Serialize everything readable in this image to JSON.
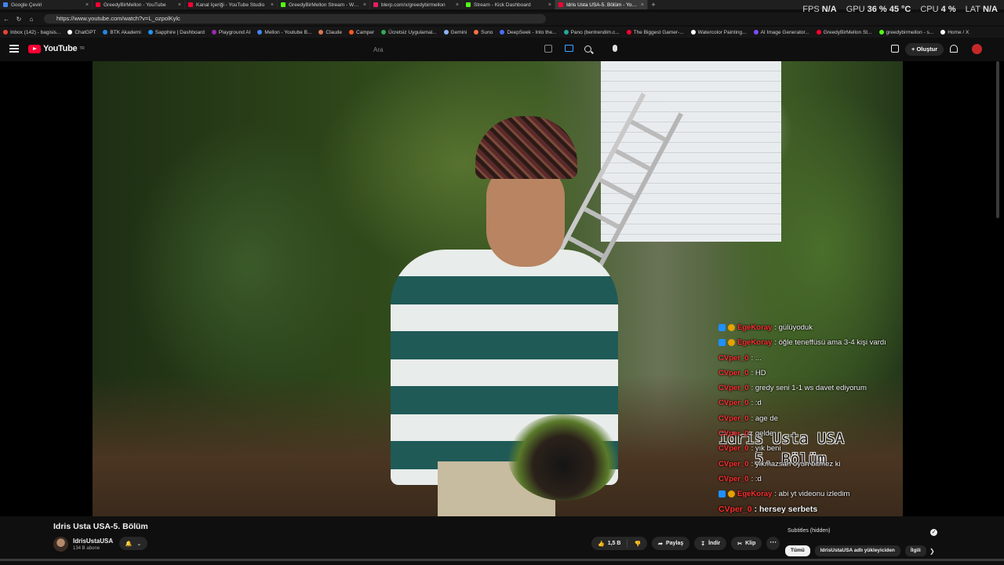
{
  "browser": {
    "tabs": [
      {
        "label": "Google Çeviri",
        "color": "#4285f4",
        "active": false
      },
      {
        "label": "GreedyBirMellon - YouTube",
        "color": "#ff0033",
        "active": false
      },
      {
        "label": "Kanal İçeriği - YouTube Studio",
        "color": "#ff0033",
        "active": false
      },
      {
        "label": "GreedyBirMellon Stream - Watch",
        "color": "#53fc18",
        "active": false
      },
      {
        "label": "blerp.com/x/greedybirmellon",
        "color": "#e91e63",
        "active": false
      },
      {
        "label": "Stream - Kick Dashboard",
        "color": "#53fc18",
        "active": false
      },
      {
        "label": "Idris Usta USA-5. Bölüm - YouTube",
        "color": "#ff0033",
        "active": true
      }
    ],
    "new_tab": "+",
    "url": "https://www.youtube.com/watch?v=L_ozpolKylc",
    "bookmarks": [
      {
        "label": "Inbox (142) - bagisis...",
        "color": "#ea4335"
      },
      {
        "label": "ChatGPT",
        "color": "#ffffff"
      },
      {
        "label": "BTK Akademi",
        "color": "#1e88e5"
      },
      {
        "label": "Sapphire | Dashboard",
        "color": "#2196f3"
      },
      {
        "label": "Playground AI",
        "color": "#9c27b0"
      },
      {
        "label": "Mellon - Youtube B...",
        "color": "#4285f4"
      },
      {
        "label": "Claude",
        "color": "#d97757"
      },
      {
        "label": "Camper",
        "color": "#ff5722"
      },
      {
        "label": "Ücretsiz Uygulamal...",
        "color": "#34a853"
      },
      {
        "label": "Gemini",
        "color": "#8ab4f8"
      },
      {
        "label": "Suno",
        "color": "#ff7043"
      },
      {
        "label": "DeepSeek - Into the...",
        "color": "#4d6bfe"
      },
      {
        "label": "Pano (bentrendim.c...",
        "color": "#26a69a"
      },
      {
        "label": "The Biggest Gamer-...",
        "color": "#ff0033"
      },
      {
        "label": "Watercolor Painting...",
        "color": "#ffffff"
      },
      {
        "label": "AI Image Generator...",
        "color": "#7c4dff"
      },
      {
        "label": "GreedyBirMellon St...",
        "color": "#ff0033"
      },
      {
        "label": "greedybirmellon - s...",
        "color": "#53fc18"
      },
      {
        "label": "Home / X",
        "color": "#ffffff"
      }
    ]
  },
  "hud": {
    "fps_label": "FPS",
    "fps_value": "N/A",
    "gpu_label": "GPU",
    "gpu_value": "36 % 45 °C",
    "cpu_label": "CPU",
    "cpu_value": "4 %",
    "lat_label": "LAT",
    "lat_value": "N/A"
  },
  "youtube": {
    "logo": "YouTube",
    "region": "TR",
    "search_placeholder": "Ara",
    "create_label": "+ Oluştur"
  },
  "video": {
    "title": "Idris Usta USA-5. Bölüm",
    "overlay_title": "Idris Usta USA",
    "overlay_sub": "5. Bölüm",
    "chat": [
      {
        "user": "EgeKoray",
        "msg": ": gülüyoduk",
        "badges": true
      },
      {
        "user": "EgeKoray",
        "msg": ": öğle teneffüsü ama 3-4 kişi vardı",
        "badges": true
      },
      {
        "user": "CVper_0",
        "msg": ": ..."
      },
      {
        "user": "CVper_0",
        "msg": ": HD"
      },
      {
        "user": "CVper_0",
        "msg": ": gredy seni 1-1 ws davet ediyorum"
      },
      {
        "user": "CVper_0",
        "msg": ": :d"
      },
      {
        "user": "CVper_0",
        "msg": ": age de"
      },
      {
        "user": "CVper_0",
        "msg": ": gelde"
      },
      {
        "user": "CVper_0",
        "msg": ": yık beni"
      },
      {
        "user": "CVper_0",
        "msg": ": yıkmazsan oyun bitmez ki"
      },
      {
        "user": "CVper_0",
        "msg": ": :d"
      },
      {
        "user": "EgeKoray",
        "msg": ": abi yt videonu izledim",
        "badges": true
      },
      {
        "user": "CVper_0",
        "msg": ": hersey serbets",
        "strong": true
      }
    ]
  },
  "channel": {
    "name": "IdrisUstaUSA",
    "subscribers": "134 B abone"
  },
  "actions": {
    "likes": "1,5 B",
    "share": "Paylaş",
    "download": "İndir",
    "clip": "Klip",
    "more": "···"
  },
  "side": {
    "subtitles": "Subtitles (hidden)",
    "chips": [
      "Tümü",
      "IdrisUstaUSA adlı yükleyiciden",
      "İlgili"
    ]
  }
}
